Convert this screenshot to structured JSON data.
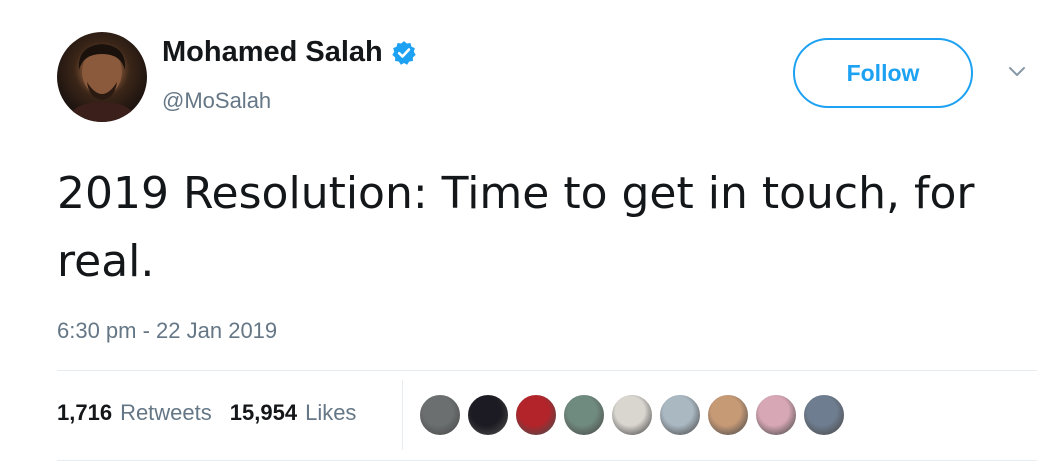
{
  "user": {
    "display_name": "Mohamed Salah",
    "handle": "@MoSalah",
    "verified": true,
    "avatar_icon": "profile-photo"
  },
  "actions": {
    "follow_label": "Follow",
    "more_icon": "chevron-down-icon"
  },
  "tweet": {
    "text": "2019 Resolution: Time to get in touch, for real.",
    "timestamp": "6:30 pm - 22 Jan 2019"
  },
  "stats": {
    "retweets_count": "1,716",
    "retweets_label": "Retweets",
    "likes_count": "15,954",
    "likes_label": "Likes"
  },
  "likers": [
    {
      "color": "#6b6f70"
    },
    {
      "color": "#1c1a22"
    },
    {
      "color": "#b3242a"
    },
    {
      "color": "#6f8a7e"
    },
    {
      "color": "#d9d5cf"
    },
    {
      "color": "#aab8c2"
    },
    {
      "color": "#c79a76"
    },
    {
      "color": "#d8a7b5"
    },
    {
      "color": "#6e7d90"
    }
  ],
  "colors": {
    "brand_blue": "#1da1f2",
    "secondary_text": "#657786",
    "primary_text": "#14171a"
  }
}
